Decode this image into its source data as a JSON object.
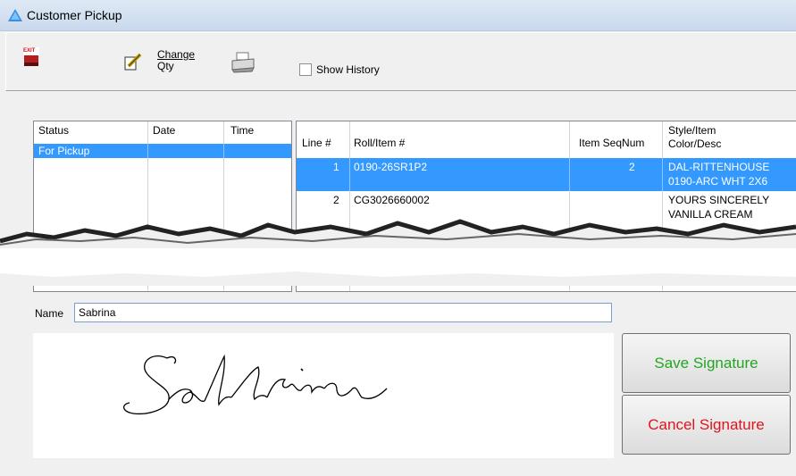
{
  "window": {
    "title": "Customer Pickup"
  },
  "toolbar": {
    "exit_icon_text": "EXIT",
    "change_qty_line1": "Change",
    "change_qty_line2": "Qty",
    "show_history_label": "Show History",
    "show_history_checked": false
  },
  "status_list": {
    "columns": [
      "Status",
      "Date",
      "Time"
    ],
    "rows": [
      {
        "status": "For Pickup",
        "date": "",
        "time": "",
        "selected": true
      }
    ]
  },
  "items_list": {
    "columns": [
      "Line #",
      "Roll/Item #",
      "Item SeqNum",
      "Style/Item",
      "Color/Desc"
    ],
    "rows": [
      {
        "line": "1",
        "roll_item": "0190-26SR1P2",
        "seqnum": "2",
        "style": "DAL-RITTENHOUSE",
        "color": "0190-ARC WHT 2X6",
        "selected": true
      },
      {
        "line": "2",
        "roll_item": "CG3026660002",
        "seqnum": "",
        "style": "YOURS SINCERELY",
        "color": "VANILLA CREAM",
        "selected": false
      }
    ]
  },
  "signature": {
    "name_label": "Name",
    "name_value": "Sabrina",
    "save_label": "Save Signature",
    "cancel_label": "Cancel Signature",
    "save_color": "#22a622",
    "cancel_color": "#e0141e"
  },
  "colors": {
    "selection": "#3399ff",
    "titlebar": "#d4e1f0"
  }
}
